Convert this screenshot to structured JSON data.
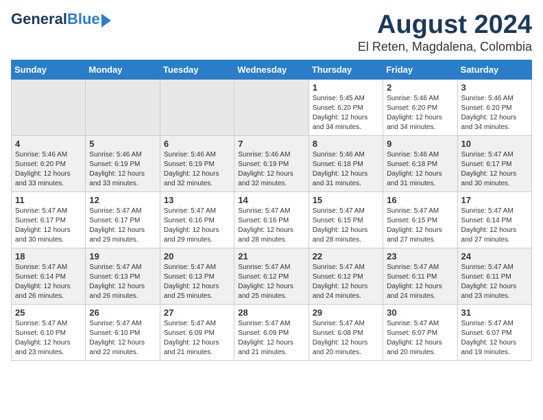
{
  "logo": {
    "line1": "General",
    "line2": "Blue"
  },
  "title": "August 2024",
  "subtitle": "El Reten, Magdalena, Colombia",
  "days_of_week": [
    "Sunday",
    "Monday",
    "Tuesday",
    "Wednesday",
    "Thursday",
    "Friday",
    "Saturday"
  ],
  "weeks": [
    [
      {
        "day": "",
        "content": ""
      },
      {
        "day": "",
        "content": ""
      },
      {
        "day": "",
        "content": ""
      },
      {
        "day": "",
        "content": ""
      },
      {
        "day": "1",
        "content": "Sunrise: 5:45 AM\nSunset: 6:20 PM\nDaylight: 12 hours\nand 34 minutes."
      },
      {
        "day": "2",
        "content": "Sunrise: 5:46 AM\nSunset: 6:20 PM\nDaylight: 12 hours\nand 34 minutes."
      },
      {
        "day": "3",
        "content": "Sunrise: 5:46 AM\nSunset: 6:20 PM\nDaylight: 12 hours\nand 34 minutes."
      }
    ],
    [
      {
        "day": "4",
        "content": "Sunrise: 5:46 AM\nSunset: 6:20 PM\nDaylight: 12 hours\nand 33 minutes."
      },
      {
        "day": "5",
        "content": "Sunrise: 5:46 AM\nSunset: 6:19 PM\nDaylight: 12 hours\nand 33 minutes."
      },
      {
        "day": "6",
        "content": "Sunrise: 5:46 AM\nSunset: 6:19 PM\nDaylight: 12 hours\nand 32 minutes."
      },
      {
        "day": "7",
        "content": "Sunrise: 5:46 AM\nSunset: 6:19 PM\nDaylight: 12 hours\nand 32 minutes."
      },
      {
        "day": "8",
        "content": "Sunrise: 5:46 AM\nSunset: 6:18 PM\nDaylight: 12 hours\nand 31 minutes."
      },
      {
        "day": "9",
        "content": "Sunrise: 5:46 AM\nSunset: 6:18 PM\nDaylight: 12 hours\nand 31 minutes."
      },
      {
        "day": "10",
        "content": "Sunrise: 5:47 AM\nSunset: 6:17 PM\nDaylight: 12 hours\nand 30 minutes."
      }
    ],
    [
      {
        "day": "11",
        "content": "Sunrise: 5:47 AM\nSunset: 6:17 PM\nDaylight: 12 hours\nand 30 minutes."
      },
      {
        "day": "12",
        "content": "Sunrise: 5:47 AM\nSunset: 6:17 PM\nDaylight: 12 hours\nand 29 minutes."
      },
      {
        "day": "13",
        "content": "Sunrise: 5:47 AM\nSunset: 6:16 PM\nDaylight: 12 hours\nand 29 minutes."
      },
      {
        "day": "14",
        "content": "Sunrise: 5:47 AM\nSunset: 6:16 PM\nDaylight: 12 hours\nand 28 minutes."
      },
      {
        "day": "15",
        "content": "Sunrise: 5:47 AM\nSunset: 6:15 PM\nDaylight: 12 hours\nand 28 minutes."
      },
      {
        "day": "16",
        "content": "Sunrise: 5:47 AM\nSunset: 6:15 PM\nDaylight: 12 hours\nand 27 minutes."
      },
      {
        "day": "17",
        "content": "Sunrise: 5:47 AM\nSunset: 6:14 PM\nDaylight: 12 hours\nand 27 minutes."
      }
    ],
    [
      {
        "day": "18",
        "content": "Sunrise: 5:47 AM\nSunset: 6:14 PM\nDaylight: 12 hours\nand 26 minutes."
      },
      {
        "day": "19",
        "content": "Sunrise: 5:47 AM\nSunset: 6:13 PM\nDaylight: 12 hours\nand 26 minutes."
      },
      {
        "day": "20",
        "content": "Sunrise: 5:47 AM\nSunset: 6:13 PM\nDaylight: 12 hours\nand 25 minutes."
      },
      {
        "day": "21",
        "content": "Sunrise: 5:47 AM\nSunset: 6:12 PM\nDaylight: 12 hours\nand 25 minutes."
      },
      {
        "day": "22",
        "content": "Sunrise: 5:47 AM\nSunset: 6:12 PM\nDaylight: 12 hours\nand 24 minutes."
      },
      {
        "day": "23",
        "content": "Sunrise: 5:47 AM\nSunset: 6:11 PM\nDaylight: 12 hours\nand 24 minutes."
      },
      {
        "day": "24",
        "content": "Sunrise: 5:47 AM\nSunset: 6:11 PM\nDaylight: 12 hours\nand 23 minutes."
      }
    ],
    [
      {
        "day": "25",
        "content": "Sunrise: 5:47 AM\nSunset: 6:10 PM\nDaylight: 12 hours\nand 23 minutes."
      },
      {
        "day": "26",
        "content": "Sunrise: 5:47 AM\nSunset: 6:10 PM\nDaylight: 12 hours\nand 22 minutes."
      },
      {
        "day": "27",
        "content": "Sunrise: 5:47 AM\nSunset: 6:09 PM\nDaylight: 12 hours\nand 21 minutes."
      },
      {
        "day": "28",
        "content": "Sunrise: 5:47 AM\nSunset: 6:09 PM\nDaylight: 12 hours\nand 21 minutes."
      },
      {
        "day": "29",
        "content": "Sunrise: 5:47 AM\nSunset: 6:08 PM\nDaylight: 12 hours\nand 20 minutes."
      },
      {
        "day": "30",
        "content": "Sunrise: 5:47 AM\nSunset: 6:07 PM\nDaylight: 12 hours\nand 20 minutes."
      },
      {
        "day": "31",
        "content": "Sunrise: 5:47 AM\nSunset: 6:07 PM\nDaylight: 12 hours\nand 19 minutes."
      }
    ]
  ]
}
